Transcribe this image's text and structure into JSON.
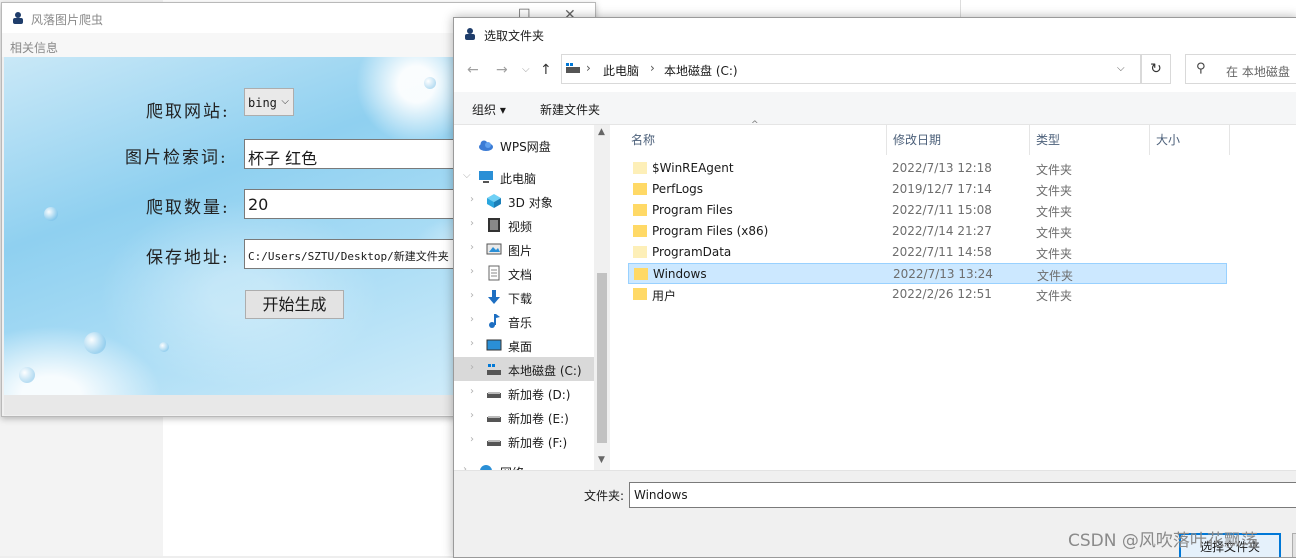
{
  "app": {
    "title": "风落图片爬虫",
    "menu": "相关信息",
    "form": {
      "site_label": "爬取网站:",
      "site_value": "bing",
      "keyword_label": "图片检索词:",
      "keyword_value": "杯子 红色",
      "count_label": "爬取数量:",
      "count_value": "20",
      "path_label": "保存地址:",
      "path_value": "C:/Users/SZTU/Desktop/新建文件夹",
      "start_button": "开始生成"
    }
  },
  "dialog": {
    "title": "选取文件夹",
    "address": [
      "此电脑",
      "本地磁盘 (C:)"
    ],
    "search_placeholder": "在 本地磁盘",
    "toolbar": {
      "organize": "组织 ▾",
      "new_folder": "新建文件夹"
    },
    "nav": [
      {
        "label": "WPS网盘",
        "icon": "cloud-icon"
      },
      {
        "label": "此电脑",
        "icon": "computer-icon"
      },
      {
        "label": "3D 对象",
        "icon": "cube-icon"
      },
      {
        "label": "视频",
        "icon": "video-icon"
      },
      {
        "label": "图片",
        "icon": "picture-icon"
      },
      {
        "label": "文档",
        "icon": "document-icon"
      },
      {
        "label": "下载",
        "icon": "download-icon"
      },
      {
        "label": "音乐",
        "icon": "music-icon"
      },
      {
        "label": "桌面",
        "icon": "desktop-icon"
      },
      {
        "label": "本地磁盘 (C:)",
        "icon": "drive-icon"
      },
      {
        "label": "新加卷 (D:)",
        "icon": "drive-icon"
      },
      {
        "label": "新加卷 (E:)",
        "icon": "drive-icon"
      },
      {
        "label": "新加卷 (F:)",
        "icon": "drive-icon"
      },
      {
        "label": "网络",
        "icon": "network-icon"
      }
    ],
    "columns": {
      "name": "名称",
      "date": "修改日期",
      "type": "类型",
      "size": "大小"
    },
    "rows": [
      {
        "name": "$WinREAgent",
        "date": "2022/7/13 12:18",
        "type": "文件夹"
      },
      {
        "name": "PerfLogs",
        "date": "2019/12/7 17:14",
        "type": "文件夹"
      },
      {
        "name": "Program Files",
        "date": "2022/7/11 15:08",
        "type": "文件夹"
      },
      {
        "name": "Program Files (x86)",
        "date": "2022/7/14 21:27",
        "type": "文件夹"
      },
      {
        "name": "ProgramData",
        "date": "2022/7/11 14:58",
        "type": "文件夹"
      },
      {
        "name": "Windows",
        "date": "2022/7/13 13:24",
        "type": "文件夹"
      },
      {
        "name": "用户",
        "date": "2022/2/26 12:51",
        "type": "文件夹"
      }
    ],
    "folder_label": "文件夹:",
    "folder_value": "Windows",
    "select_button": "选择文件夹"
  },
  "watermark": "CSDN @风吹落叶花飘荡",
  "colors": {
    "selection": "#cce8ff",
    "accent": "#0078d7",
    "folder": "#ffd966"
  }
}
